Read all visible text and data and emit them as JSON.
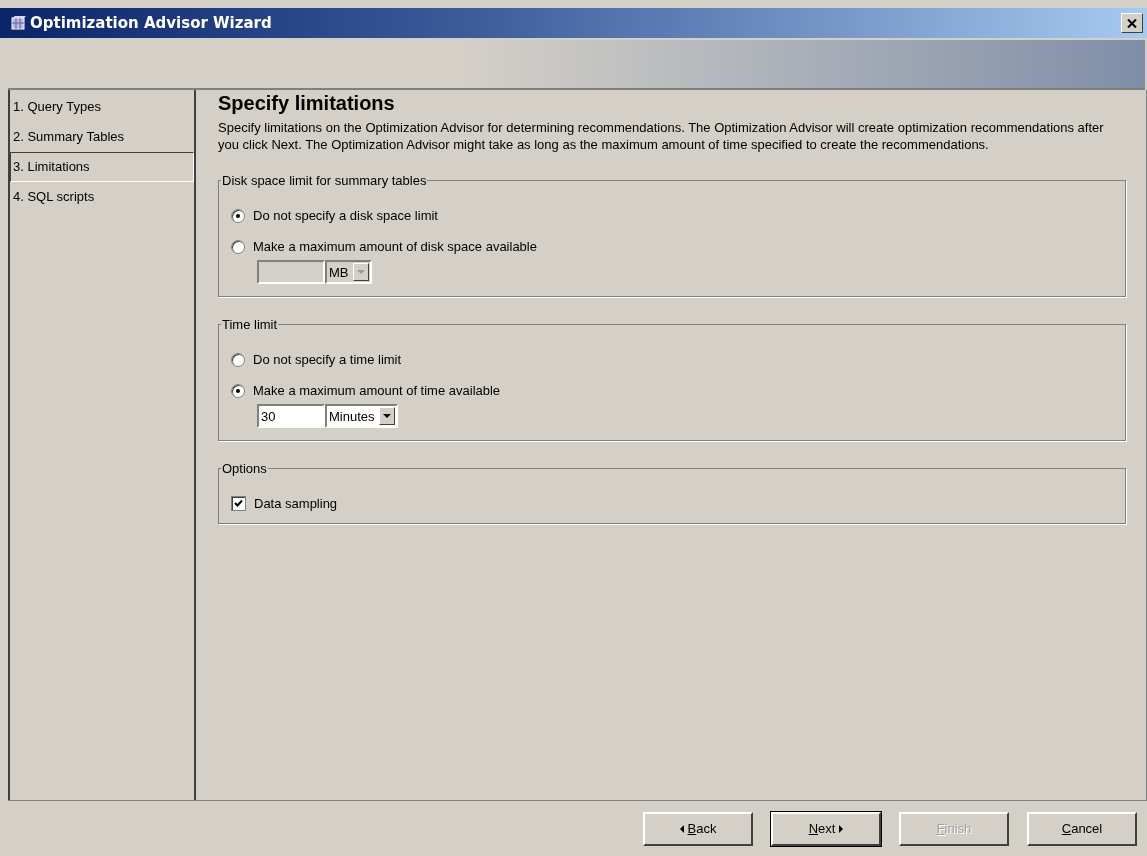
{
  "window": {
    "title": "Optimization Advisor Wizard"
  },
  "steps": [
    {
      "label": "1. Query Types",
      "selected": false
    },
    {
      "label": "2. Summary Tables",
      "selected": false
    },
    {
      "label": "3. Limitations",
      "selected": true
    },
    {
      "label": "4. SQL scripts",
      "selected": false
    }
  ],
  "page": {
    "heading": "Specify limitations",
    "description": "Specify limitations on the Optimization Advisor for determining recommendations. The Optimization Advisor will create optimization recommendations after you click Next. The Optimization Advisor might take as long as the maximum amount of time specified to create the recommendations."
  },
  "groups": [
    {
      "title": "Disk space limit for summary tables",
      "items": [
        {
          "kind": "radio",
          "label": "Do not specify a disk space limit",
          "selected": true
        },
        {
          "kind": "radio",
          "label": "Make a maximum amount of disk space available",
          "selected": false
        },
        {
          "kind": "amount",
          "value": "",
          "unit": "MB",
          "disabled": true
        }
      ]
    },
    {
      "title": "Time limit",
      "items": [
        {
          "kind": "radio",
          "label": "Do not specify a time limit",
          "selected": false
        },
        {
          "kind": "radio",
          "label": "Make a maximum amount of time available",
          "selected": true
        },
        {
          "kind": "amount",
          "value": "30",
          "unit": "Minutes",
          "disabled": false
        }
      ]
    },
    {
      "title": "Options",
      "items": [
        {
          "kind": "checkbox",
          "label": "Data sampling",
          "checked": true
        }
      ]
    }
  ],
  "buttons": [
    {
      "label": "Back",
      "kind": "back",
      "disabled": false,
      "default": false
    },
    {
      "label": "Next",
      "kind": "next",
      "disabled": false,
      "default": true
    },
    {
      "label": "Finish",
      "kind": "plain",
      "disabled": true,
      "default": false
    },
    {
      "label": "Cancel",
      "kind": "plain",
      "disabled": false,
      "default": false
    }
  ]
}
